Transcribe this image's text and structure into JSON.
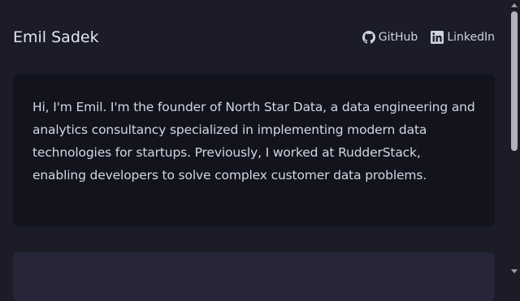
{
  "header": {
    "site_name": "Emil Sadek",
    "links": [
      {
        "label": "GitHub",
        "icon": "github-icon"
      },
      {
        "label": "LinkedIn",
        "icon": "linkedin-icon"
      }
    ]
  },
  "intro": {
    "text": "Hi, I'm Emil. I'm the founder of North Star Data, a data engineering and analytics consultancy specialized in implementing modern data technologies for startups. Previously, I worked at RudderStack, enabling developers to solve complex customer data problems."
  },
  "colors": {
    "background": "#1b1c28",
    "card": "#12131d",
    "next_card": "#262638",
    "text": "#d4d6e2"
  }
}
